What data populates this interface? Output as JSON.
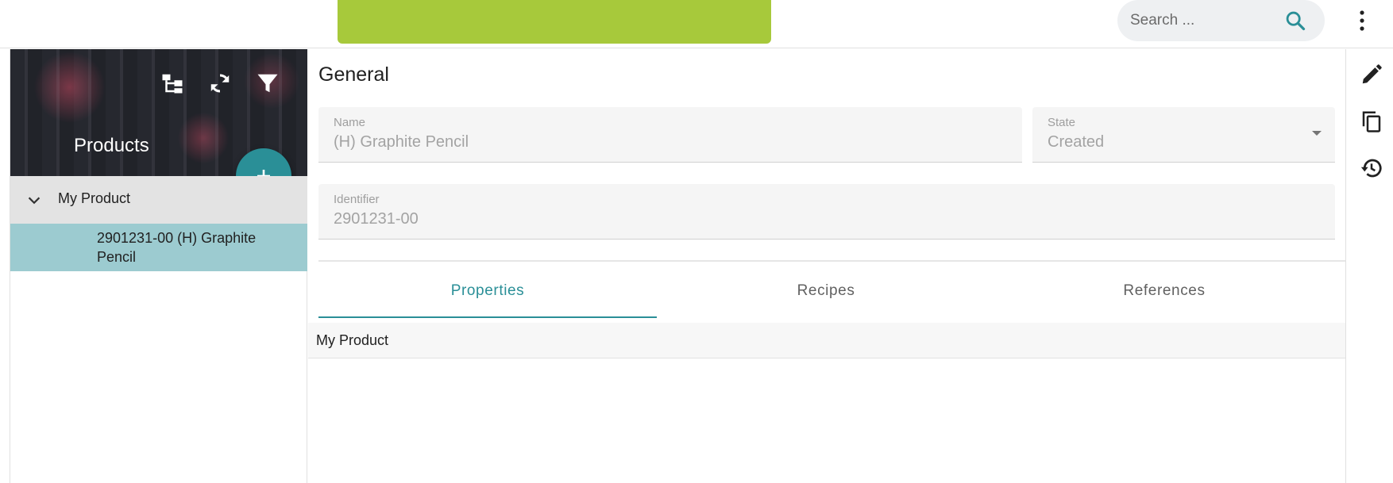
{
  "search": {
    "placeholder": "Search ..."
  },
  "sidebar": {
    "title": "Products",
    "add_button": "+",
    "tree": {
      "root_label": "My Product",
      "child_label": "2901231-00 (H) Graphite Pencil"
    }
  },
  "main": {
    "section_title": "General",
    "fields": {
      "name": {
        "label": "Name",
        "value": "(H) Graphite Pencil"
      },
      "state": {
        "label": "State",
        "value": "Created"
      },
      "identifier": {
        "label": "Identifier",
        "value": "2901231-00"
      }
    },
    "tabs": [
      {
        "label": "Properties",
        "active": true
      },
      {
        "label": "Recipes",
        "active": false
      },
      {
        "label": "References",
        "active": false
      }
    ],
    "panel_label": "My Product"
  },
  "icons": {
    "top": [
      "search-icon",
      "more-vert-icon"
    ],
    "sidebar": [
      "tree-view-icon",
      "sync-icon",
      "filter-icon",
      "chevron-down-icon"
    ],
    "actions": [
      "pencil-icon",
      "copy-icon",
      "history-icon"
    ]
  },
  "colors": {
    "brand_banner": "#a7c93b",
    "accent": "#2a8f97",
    "selected_row": "#9ccbd0"
  }
}
